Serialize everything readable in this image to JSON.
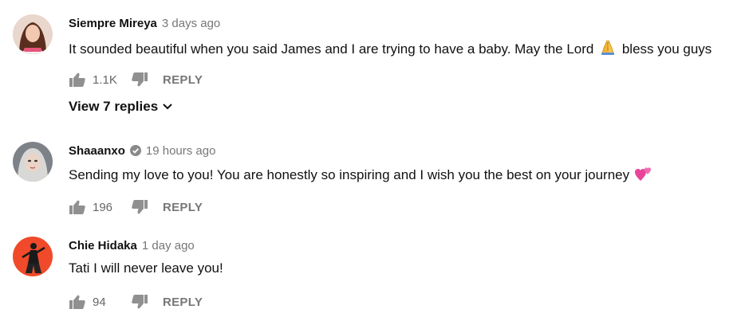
{
  "comments": [
    {
      "author": "Siempre Mireya",
      "timestamp": "3 days ago",
      "text_before": "It sounded beautiful when you said James and I are trying to have a baby. May the Lord",
      "emoji": "folded-hands-emoji",
      "text_after": "bless you guys",
      "likes": "1.1K",
      "reply_label": "REPLY",
      "view_replies": "View 7 replies",
      "avatar_color": "#d9b8a8"
    },
    {
      "author": "Shaaanxo",
      "verified": true,
      "timestamp": "19 hours ago",
      "text_before": "Sending my love to you! You are honestly so inspiring and I wish you the best on your journey",
      "emoji": "two-hearts-emoji",
      "likes": "196",
      "reply_label": "REPLY",
      "avatar_color": "#9aa0a6"
    },
    {
      "author": "Chie Hidaka",
      "timestamp": "1 day ago",
      "text_before": "Tati I will never leave you!",
      "likes": "94",
      "reply_label": "REPLY",
      "avatar_color": "#f04a2a"
    }
  ],
  "colors": {
    "author": "#111111",
    "meta": "#777777",
    "icon": "#909090"
  }
}
